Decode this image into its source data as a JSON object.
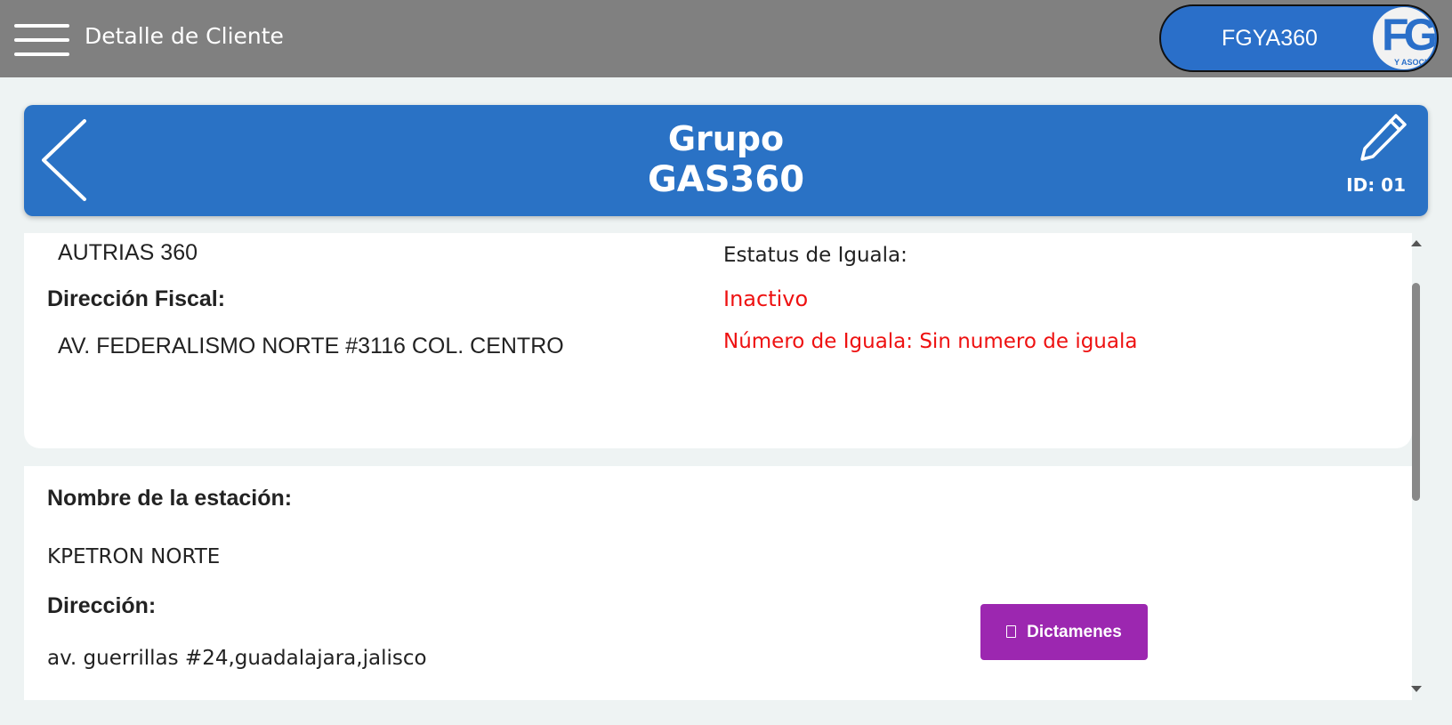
{
  "topbar": {
    "title": "Detalle de Cliente",
    "user_label": "FGYA360",
    "logo_text": "FG",
    "logo_subtext": "Y ASOCI"
  },
  "header": {
    "title_line1": "Grupo",
    "title_line2": "GAS360",
    "id_label": "ID: 01",
    "background_color": "#2a72c5"
  },
  "client_info": {
    "name_value": "AUTRIAS 360",
    "fiscal_address_label": "Dirección Fiscal:",
    "fiscal_address_value": "AV. FEDERALISMO NORTE #3116 COL. CENTRO",
    "fee_status_label": "Estatus de Iguala:",
    "fee_status_value": "Inactivo",
    "fee_number_text": "Número de Iguala: Sin numero de iguala",
    "status_color": "#ee1111"
  },
  "station": {
    "name_label": "Nombre de la estación:",
    "name_value": "KPETRON NORTE",
    "address_label": "Dirección:",
    "address_value": "av. guerrillas #24,guadalajara,jalisco",
    "dictamenes_button": "Dictamenes",
    "button_color": "#9c27b0"
  },
  "icons": {
    "menu": "hamburger-icon",
    "back": "chevron-left-icon",
    "edit": "pencil-icon",
    "document": "file-icon"
  }
}
